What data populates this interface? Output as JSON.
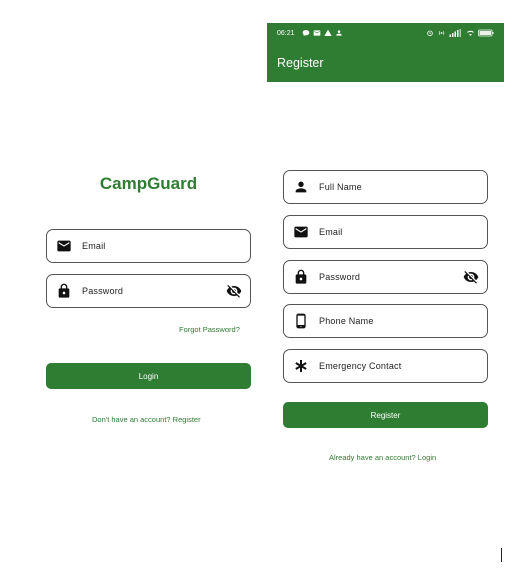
{
  "login": {
    "app_title": "CampGuard",
    "email_label": "Email",
    "password_label": "Password",
    "forgot_password": "Forgot Password?",
    "login_button": "Login",
    "register_link": "Don't have an account? Register"
  },
  "register": {
    "status_bar": {
      "time": "06:21",
      "battery": "100"
    },
    "app_bar_title": "Register",
    "full_name_label": "Full Name",
    "email_label": "Email",
    "password_label": "Password",
    "phone_label": "Phone Name",
    "emergency_label": "Emergency Contact",
    "register_button": "Register",
    "login_link": "Already have an account? Login"
  },
  "colors": {
    "primary_green": "#2e7d32",
    "field_border": "#555555",
    "text": "#222222"
  }
}
